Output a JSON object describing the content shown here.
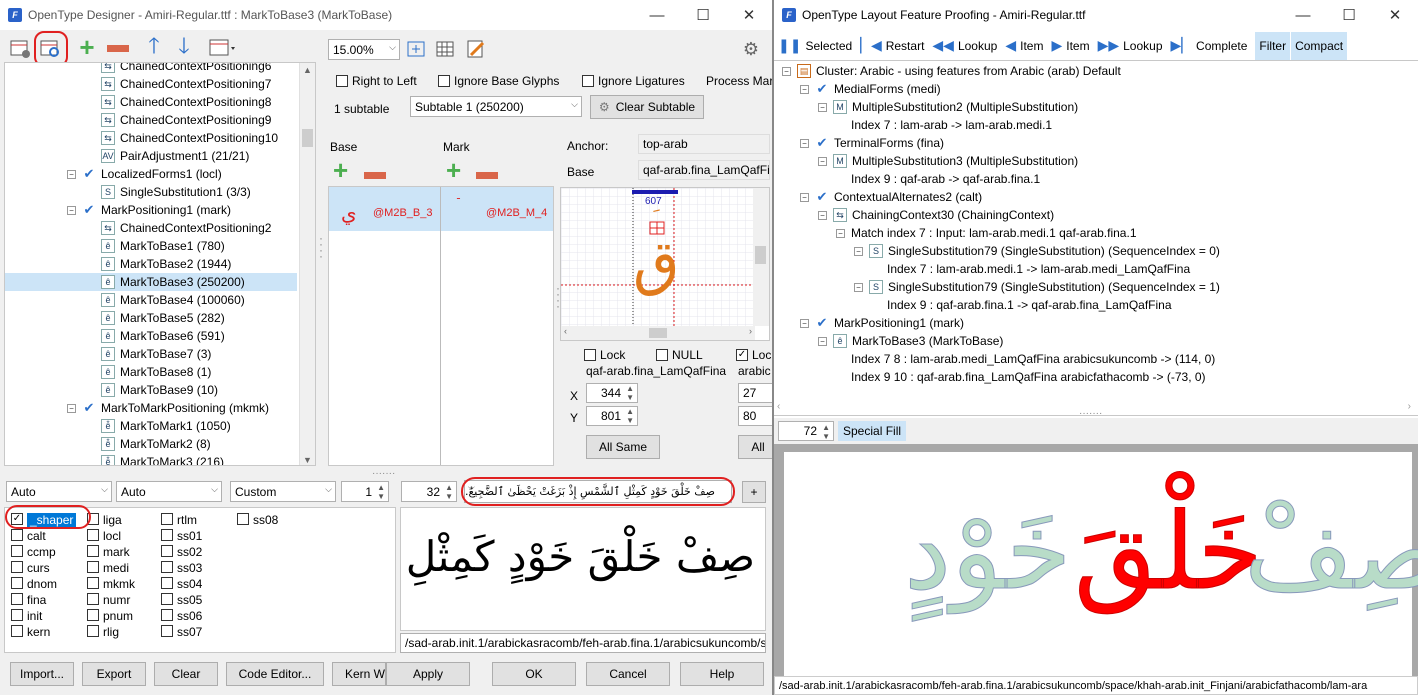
{
  "designer": {
    "title": "OpenType Designer - Amiri-Regular.ttf : MarkToBase3 (MarkToBase)",
    "zoom": "15.00%",
    "tree": [
      {
        "label": "ChainedContextPositioning6",
        "indent": 2,
        "icon": "chain-icon"
      },
      {
        "label": "ChainedContextPositioning7",
        "indent": 2,
        "icon": "chain-icon"
      },
      {
        "label": "ChainedContextPositioning8",
        "indent": 2,
        "icon": "chain-icon"
      },
      {
        "label": "ChainedContextPositioning9",
        "indent": 2,
        "icon": "chain-icon"
      },
      {
        "label": "ChainedContextPositioning10",
        "indent": 2,
        "icon": "chain-icon"
      },
      {
        "label": "PairAdjustment1 (21/21)",
        "indent": 2,
        "icon": "pair-icon"
      },
      {
        "label": "LocalizedForms1 (locl)",
        "indent": 1,
        "icon": "check-icon"
      },
      {
        "label": "SingleSubstitution1 (3/3)",
        "indent": 2,
        "icon": "s-icon"
      },
      {
        "label": "MarkPositioning1 (mark)",
        "indent": 1,
        "icon": "check-icon"
      },
      {
        "label": "ChainedContextPositioning2",
        "indent": 2,
        "icon": "chain-icon"
      },
      {
        "label": "MarkToBase1 (780)",
        "indent": 2,
        "icon": "mark-icon"
      },
      {
        "label": "MarkToBase2 (1944)",
        "indent": 2,
        "icon": "mark-icon"
      },
      {
        "label": "MarkToBase3 (250200)",
        "indent": 2,
        "icon": "mark-icon"
      },
      {
        "label": "MarkToBase4 (100060)",
        "indent": 2,
        "icon": "mark-icon"
      },
      {
        "label": "MarkToBase5 (282)",
        "indent": 2,
        "icon": "mark-icon"
      },
      {
        "label": "MarkToBase6 (591)",
        "indent": 2,
        "icon": "mark-icon"
      },
      {
        "label": "MarkToBase7 (3)",
        "indent": 2,
        "icon": "mark-icon"
      },
      {
        "label": "MarkToBase8 (1)",
        "indent": 2,
        "icon": "mark-icon"
      },
      {
        "label": "MarkToBase9 (10)",
        "indent": 2,
        "icon": "mark-icon"
      },
      {
        "label": "MarkToMarkPositioning (mkmk)",
        "indent": 1,
        "icon": "check-icon"
      },
      {
        "label": "MarkToMark1 (1050)",
        "indent": 2,
        "icon": "mkmk-icon"
      },
      {
        "label": "MarkToMark2 (8)",
        "indent": 2,
        "icon": "mkmk-icon"
      },
      {
        "label": "MarkToMark3 (216)",
        "indent": 2,
        "icon": "mkmk-icon"
      }
    ],
    "selected_tree_label": "MarkToBase3 (250200)",
    "right_to_left": "Right to Left",
    "ignore_base": "Ignore Base Glyphs",
    "ignore_ligatures": "Ignore Ligatures",
    "process_marks": "Process Mar",
    "subtable_count": "1 subtable",
    "subtable_value": "Subtable 1 (250200)",
    "clear_subtable": "Clear Subtable",
    "base_label": "Base",
    "mark_label": "Mark",
    "anchor_label": "Anchor:",
    "anchor_value": "top-arab",
    "base2_label": "Base",
    "base_value": "qaf-arab.fina_LamQafFin",
    "base_cell_glyph": "ي",
    "base_cell_class": "@M2B_B_3",
    "mark_cell_class": "@M2B_M_4",
    "preview_number": "607",
    "base_glyph": "ق",
    "lock_label": "Lock",
    "null_label": "NULL",
    "lock2_label": "Loc",
    "glyph_name": "qaf-arab.fina_LamQafFina",
    "glyph_name2": "arabic",
    "x_label": "X",
    "y_label": "Y",
    "x_value": "344",
    "y_value": "801",
    "x_value2": "27",
    "y_value2": "80",
    "all_same": "All Same",
    "all2": "All",
    "script_combo": "Auto",
    "lang_combo": "Auto",
    "mode_combo": "Custom",
    "stepper1": "1",
    "font_size": "32",
    "sample_text": "صِفْ خَلْقَ خَوْدٍ كَمِثْلِ ٱلشَّمْسِ إِذْ بَزَغَتْ يَحْظَىٰ ٱلضَّجِيعُ.",
    "features": [
      [
        "_shaper",
        "liga",
        "rtlm",
        "ss08"
      ],
      [
        "calt",
        "locl",
        "ss01",
        ""
      ],
      [
        "ccmp",
        "mark",
        "ss02",
        ""
      ],
      [
        "curs",
        "medi",
        "ss03",
        ""
      ],
      [
        "dnom",
        "mkmk",
        "ss04",
        ""
      ],
      [
        "fina",
        "numr",
        "ss05",
        ""
      ],
      [
        "init",
        "pnum",
        "ss06",
        ""
      ],
      [
        "kern",
        "rlig",
        "ss07",
        ""
      ]
    ],
    "render_text": "صِفْ خَلْقَ خَوْدٍ كَمِثْلِ",
    "glyph_path": "/sad-arab.init.1/arabickasracomb/feh-arab.fina.1/arabicsukuncomb/s",
    "buttons": {
      "import": "Import...",
      "export": "Export",
      "clear": "Clear",
      "code_editor": "Code Editor...",
      "kern": "Kern W",
      "apply": "Apply",
      "ok": "OK",
      "cancel": "Cancel",
      "help": "Help"
    }
  },
  "proofing": {
    "title": "OpenType Layout Feature Proofing - Amiri-Regular.ttf",
    "toolbar": {
      "selected": "Selected",
      "restart": "Restart",
      "lookup_back": "Lookup",
      "item_back": "Item",
      "item_fwd": "Item",
      "lookup_fwd": "Lookup",
      "complete": "Complete",
      "filter": "Filter",
      "compact": "Compact"
    },
    "tree": [
      {
        "label": "Cluster: Arabic - using features from Arabic (arab) Default",
        "indent": 0,
        "icon": "doc-icon",
        "toggle": "−"
      },
      {
        "label": "MedialForms (medi)",
        "indent": 1,
        "icon": "check-icon",
        "toggle": "−"
      },
      {
        "label": "MultipleSubstitution2 (MultipleSubstitution)",
        "indent": 2,
        "icon": "m-icon",
        "toggle": "−"
      },
      {
        "label": "Index 7 : lam-arab -> lam-arab.medi.1",
        "indent": 3,
        "icon": "",
        "toggle": ""
      },
      {
        "label": "TerminalForms (fina)",
        "indent": 1,
        "icon": "check-icon",
        "toggle": "−"
      },
      {
        "label": "MultipleSubstitution3 (MultipleSubstitution)",
        "indent": 2,
        "icon": "m-icon",
        "toggle": "−"
      },
      {
        "label": "Index 9 : qaf-arab -> qaf-arab.fina.1",
        "indent": 3,
        "icon": "",
        "toggle": ""
      },
      {
        "label": "ContextualAlternates2 (calt)",
        "indent": 1,
        "icon": "check-icon",
        "toggle": "−"
      },
      {
        "label": "ChainingContext30 (ChainingContext)",
        "indent": 2,
        "icon": "chain-icon",
        "toggle": "−"
      },
      {
        "label": "Match index 7 : Input: lam-arab.medi.1 qaf-arab.fina.1",
        "indent": 3,
        "icon": "",
        "toggle": "−"
      },
      {
        "label": "SingleSubstitution79 (SingleSubstitution) (SequenceIndex = 0)",
        "indent": 4,
        "icon": "s-icon",
        "toggle": "−"
      },
      {
        "label": "Index 7 : lam-arab.medi.1 -> lam-arab.medi_LamQafFina",
        "indent": 5,
        "icon": "",
        "toggle": ""
      },
      {
        "label": "SingleSubstitution79 (SingleSubstitution) (SequenceIndex = 1)",
        "indent": 4,
        "icon": "s-icon",
        "toggle": "−"
      },
      {
        "label": "Index 9 : qaf-arab.fina.1 -> qaf-arab.fina_LamQafFina",
        "indent": 5,
        "icon": "",
        "toggle": ""
      },
      {
        "label": "MarkPositioning1 (mark)",
        "indent": 1,
        "icon": "check-icon",
        "toggle": "−"
      },
      {
        "label": "MarkToBase3 (MarkToBase)",
        "indent": 2,
        "icon": "mark-icon",
        "toggle": "−"
      },
      {
        "label": "Index 7 8 : lam-arab.medi_LamQafFina arabicsukuncomb -> (114, 0)",
        "indent": 3,
        "icon": "",
        "toggle": ""
      },
      {
        "label": "Index 9 10 : qaf-arab.fina_LamQafFina arabicfathacomb -> (-73, 0)",
        "indent": 3,
        "icon": "",
        "toggle": ""
      }
    ],
    "font_size": "72",
    "special_fill": "Special Fill",
    "word_left": "خَوْدٍ",
    "word_mid": "خَلْقَ",
    "word_right": "صِفْ",
    "colors": {
      "green_fill": "#b8dcc8",
      "highlight": "#ff0000",
      "outline": "#8899bb"
    },
    "glyph_path": "/sad-arab.init.1/arabickasracomb/feh-arab.fina.1/arabicsukuncomb/space/khah-arab.init_Finjani/arabicfathacomb/lam-ara"
  }
}
